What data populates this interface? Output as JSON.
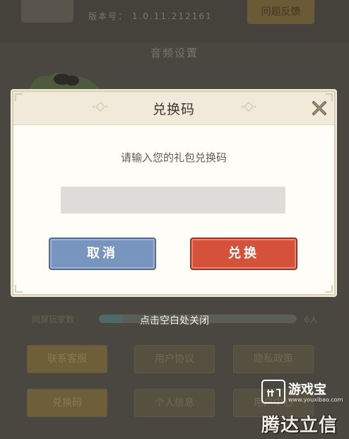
{
  "background": {
    "version_label": "版本号： 1.0.11.212161",
    "top_button_label": "问题反馈",
    "section_title": "音频设置",
    "bar_label": "同屏玩家数",
    "bar_level_percent": 12,
    "bar_count": "6人",
    "close_hint": "点击空白处关闭",
    "buttons": [
      "联系客服",
      "用户协议",
      "隐私政策",
      "兑换码",
      "个人信息",
      "用户中心"
    ]
  },
  "dialog": {
    "title": "兑换码",
    "prompt": "请输入您的礼包兑换码",
    "input_value": "",
    "input_placeholder": "",
    "cancel_label": "取消",
    "redeem_label": "兑换",
    "close_icon": "close-x-icon"
  },
  "watermark": {
    "logo_text": "游戏宝",
    "url": "www.youxibao.com",
    "slogan": "腾达立信"
  },
  "colors": {
    "cancel_button": "#7895c0",
    "redeem_button": "#d5513a",
    "dialog_header": "#f1e9da",
    "input_background": "#dedcd8",
    "overlay": "#4a4740"
  }
}
